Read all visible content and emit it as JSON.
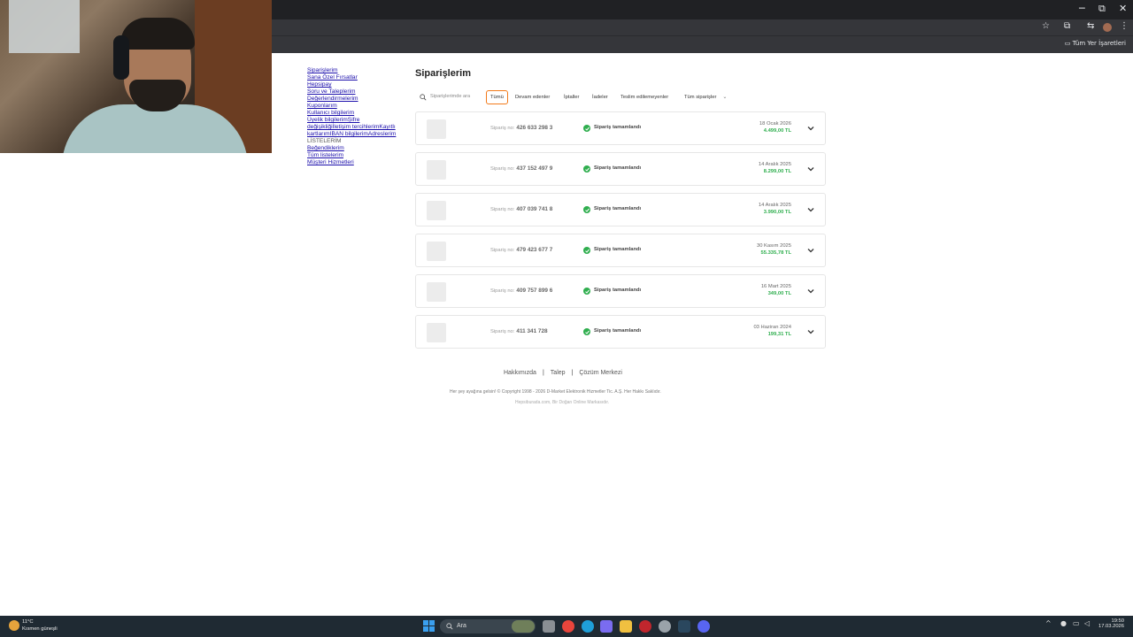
{
  "browser": {
    "controls": {
      "minimize": "─",
      "maximize": "⧉",
      "close": "✕"
    },
    "bookmarks_all_label": "Tüm Yer İşaretleri",
    "toolbar_icons": [
      "star-icon",
      "extensions-icon",
      "menu-icon"
    ]
  },
  "sidebar": {
    "items": [
      {
        "label": "Siparişlerim",
        "link": true
      },
      {
        "label": "Sana Özel Fırsatlar",
        "link": true
      },
      {
        "label": "Hepsipay",
        "link": true
      },
      {
        "label": "Soru ve Taleplerim",
        "link": true
      },
      {
        "label": "Değerlendirmelerim",
        "link": true
      },
      {
        "label": "Kuponlarım",
        "link": true
      },
      {
        "label": "Kullanıcı bilgilerim",
        "link": true
      },
      {
        "label": "Üyelik bilgilerimŞifre",
        "link": true
      },
      {
        "label": "değişikliğiİletişim tercihlerimKayıtlı",
        "link": true
      },
      {
        "label": "kartlarımIBAN bilgilerimAdreslerim",
        "link": true
      },
      {
        "label": "LİSTELERİM",
        "link": false
      },
      {
        "label": "Beğendiklerim",
        "link": true
      },
      {
        "label": "Tüm listelerim",
        "link": true
      },
      {
        "label": "Müşteri Hizmetleri",
        "link": true
      }
    ]
  },
  "main": {
    "title": "Siparişlerim",
    "search_placeholder": "Siparişlerimde ara",
    "filters": [
      "Tümü",
      "Devam edenler",
      "İptaller",
      "İadeler",
      "Teslim edilemeyenler"
    ],
    "filter_dropdown": "Tüm siparişler",
    "order_prefix": "Sipariş no:",
    "orders": [
      {
        "no": "426 633 298 3",
        "status": "Sipariş tamamlandı",
        "date": "18 Ocak 2026",
        "price": "4.499,00 TL"
      },
      {
        "no": "437 152 497 9",
        "status": "Sipariş tamamlandı",
        "date": "14 Aralık 2025",
        "price": "8.299,00 TL"
      },
      {
        "no": "407 039 741 8",
        "status": "Sipariş tamamlandı",
        "date": "14 Aralık 2025",
        "price": "3.990,00 TL"
      },
      {
        "no": "479 423 677 7",
        "status": "Sipariş tamamlandı",
        "date": "30 Kasım 2025",
        "price": "55.335,78 TL"
      },
      {
        "no": "409 757 899 6",
        "status": "Sipariş tamamlandı",
        "date": "16 Mart 2025",
        "price": "349,00 TL"
      },
      {
        "no": "411 341 728",
        "status": "Sipariş tamamlandı",
        "date": "03 Haziran 2024",
        "price": "199,31 TL"
      }
    ]
  },
  "footer": {
    "links": [
      "Hakkımızda",
      "Talep",
      "Çözüm Merkezi"
    ],
    "copyright": "Her şey ayağına gelsin! © Copyright 1998 - 2026 D-Market Elektronik Hizmetler Tic. A.Ş. Her Hakkı Saklıdır.",
    "brand": "Hepsiburada.com, Bir Doğan Online Markasıdır."
  },
  "taskbar": {
    "temperature": "11°C",
    "condition": "Kısmen güneşli",
    "search_label": "Ara",
    "time": "19:50",
    "date": "17.03.2026",
    "apps": [
      "file-explorer-icon",
      "chrome-icon",
      "edge-icon",
      "copilot-icon",
      "folder-icon",
      "media-icon",
      "settings-icon",
      "steam-icon",
      "discord-icon"
    ]
  },
  "colors": {
    "accent": "#f27a1a",
    "success": "#2fae4e",
    "link": "#1a0dab"
  }
}
